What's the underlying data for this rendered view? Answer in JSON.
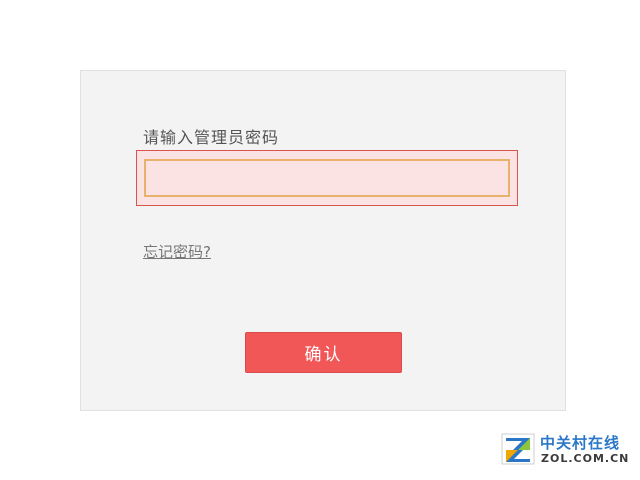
{
  "login": {
    "prompt_label": "请输入管理员密码",
    "password_value": "",
    "forgot_label": "忘记密码?",
    "confirm_label": "确认"
  },
  "watermark": {
    "brand_cn": "中关村在线",
    "brand_en": "ZOL.COM.CN",
    "logo_icon": "zol-logo-icon"
  },
  "colors": {
    "confirm_button": "#f25757",
    "input_error_border": "#d9534f",
    "input_focus_border": "#e8b26c",
    "input_error_bg": "#fbe3e3",
    "panel_bg": "#f3f3f3"
  }
}
